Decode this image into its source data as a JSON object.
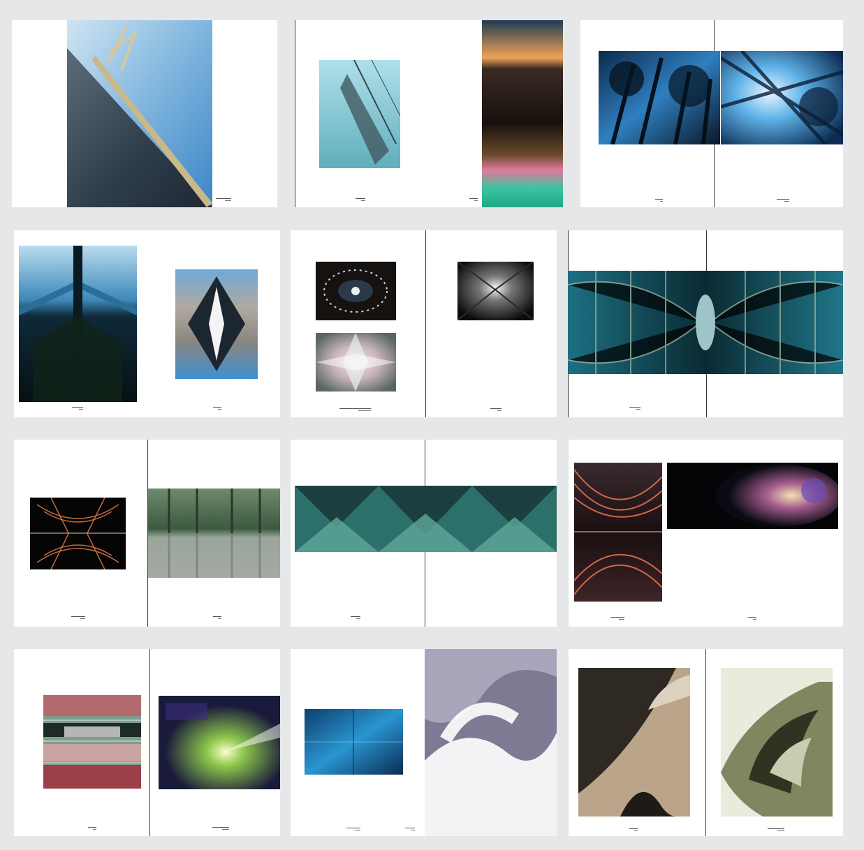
{
  "layout_sheet": {
    "background": "#e6e7e9",
    "page_color": "#ffffff",
    "spreads": [
      {
        "id": 1,
        "images": [
          "bridge-photo"
        ]
      },
      {
        "id": 2,
        "images": [
          "railway-photo",
          "sunset-photo"
        ]
      },
      {
        "id": 3,
        "images": [
          "palms-dark-photo",
          "palms-light-photo"
        ]
      },
      {
        "id": 4,
        "images": [
          "mirrored-building-photo",
          "mirrored-street-photo"
        ]
      },
      {
        "id": 5,
        "images": [
          "kaleidoscope-lights-photo",
          "kaleidoscope-pink-photo",
          "kaleidoscope-dark-photo"
        ]
      },
      {
        "id": 6,
        "images": [
          "glass-tunnel-photo"
        ]
      },
      {
        "id": 7,
        "images": [
          "orange-tunnel-photo",
          "mirrored-forest-photo"
        ]
      },
      {
        "id": 8,
        "images": [
          "teal-kaleidoscope-photo"
        ]
      },
      {
        "id": 9,
        "images": [
          "red-ribs-photo",
          "colorful-sculpture-photo"
        ]
      },
      {
        "id": 10,
        "images": [
          "colorful-building-photo",
          "light-flare-photo"
        ]
      },
      {
        "id": 11,
        "images": [
          "blue-gradient-photo",
          "white-curves-photo"
        ]
      },
      {
        "id": 12,
        "images": [
          "sand-curve-photo",
          "spiral-curve-photo"
        ]
      }
    ]
  }
}
